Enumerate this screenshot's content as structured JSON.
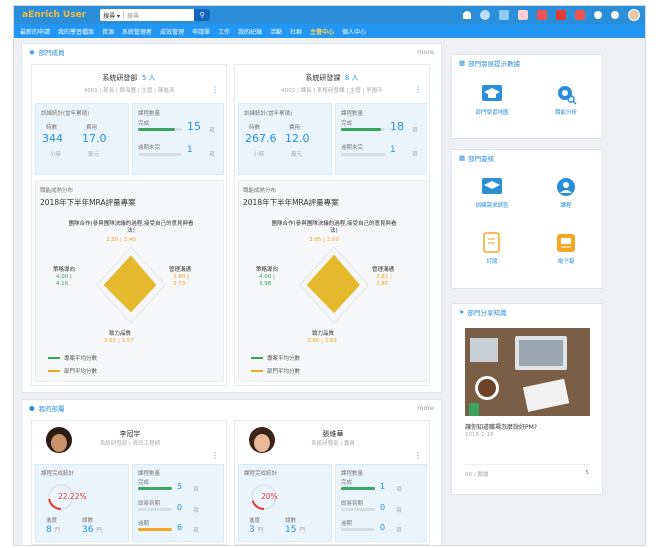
{
  "topbar": {
    "logo_a": "aEnrich",
    "logo_b": "User",
    "search_scope": "搜尋 ▾",
    "search_placeholder": "搜尋"
  },
  "nav": [
    "最新的申請",
    "我的學習檔案",
    "資源",
    "系統管理者",
    "成效管理",
    "申請單",
    "工作",
    "我的紀錄",
    "活動",
    "社群",
    "主管中心",
    "個人中心"
  ],
  "nav_active": "主管中心",
  "dept": {
    "title": "部門成員",
    "more": "more",
    "units": [
      {
        "name": "系統研發部",
        "count": "5 人",
        "meta": "4001 | 部長 | 鄭海豐 | 主管 | 陳進清",
        "hours_title": "訓練統計(當年累積)",
        "hours_lbl": "時數",
        "hours_val": "344",
        "hours_unit": "小時",
        "cost_lbl": "費用",
        "cost_val": "17.0",
        "cost_unit": "萬元",
        "course_title": "課程數量",
        "course_done_lbl": "完成",
        "course_done_val": "15",
        "course_unit": "項",
        "course_over_lbl": "逾期未完",
        "course_over_val": "1",
        "course_done_pct": 0.85,
        "radar_title": "職能成熟分布",
        "radar_sub": "2018年下半年MRA評量專案",
        "axes": [
          "團隊合作(參與團隊決議的過程,接受自己的意見與看法)",
          "管理溝通",
          "致力品質",
          "策略導向"
        ],
        "values_dept": [
          "3.50 | 3.40",
          "3.80 | 3.73",
          "3.65 | 3.57",
          "4.00 | 4.16"
        ],
        "radar_pct": [
          0.78,
          0.74,
          0.72,
          0.8
        ],
        "legend": [
          "專案平均分數",
          "部門平均分數"
        ]
      },
      {
        "name": "系統研發課",
        "count": "8 人",
        "meta": "4002 | 課長 | 系統研發課 | 主管 | 李國平",
        "hours_title": "訓練統計(當年累積)",
        "hours_lbl": "時數",
        "hours_val": "267.6",
        "hours_unit": "小時",
        "cost_lbl": "費用",
        "cost_val": "12.0",
        "cost_unit": "萬元",
        "course_title": "課程數量",
        "course_done_lbl": "完成",
        "course_done_val": "18",
        "course_unit": "項",
        "course_over_lbl": "逾期未完",
        "course_over_val": "1",
        "course_done_pct": 0.9,
        "radar_title": "職能成熟分布",
        "radar_sub": "2018年下半年MRA評量專案",
        "axes": [
          "團隊合作(參與團隊決議的過程,接受自己的意見與看法)",
          "管理溝通",
          "致力品質",
          "策略導向"
        ],
        "values_dept": [
          "3.95 | 3.60",
          "3.82 | 3.85",
          "3.86 | 3.83",
          "4.00 | 3.98"
        ],
        "radar_pct": [
          0.8,
          0.76,
          0.74,
          0.8
        ],
        "legend": [
          "專案平均分數",
          "部門平均分數"
        ]
      }
    ]
  },
  "staff": {
    "title": "我的部屬",
    "more": "more",
    "people": [
      {
        "name": "李冠宇",
        "meta": "系統研發部 | 資訊工程師",
        "stat_title": "課程完成統計",
        "pct": "22.22%",
        "pct_num": 0.2222,
        "a_lbl": "進度",
        "a_val": "8",
        "a_unit": "門",
        "b_lbl": "總數",
        "b_val": "36",
        "b_unit": "門",
        "course_title": "課程數量",
        "r1_lbl": "完成",
        "r1_val": "5",
        "r2_lbl": "即將到期",
        "r2_val": "0",
        "r3_lbl": "逾期",
        "r3_val": "6",
        "unit": "項"
      },
      {
        "name": "張維華",
        "meta": "系統研發部 | 專員",
        "stat_title": "課程完成統計",
        "pct": "20%",
        "pct_num": 0.2,
        "a_lbl": "進度",
        "a_val": "3",
        "a_unit": "門",
        "b_lbl": "總數",
        "b_val": "15",
        "b_unit": "門",
        "course_title": "課程數量",
        "r1_lbl": "完成",
        "r1_val": "1",
        "r2_lbl": "即將到期",
        "r2_val": "0",
        "r3_lbl": "逾期",
        "r3_val": "0",
        "unit": "項"
      }
    ]
  },
  "manager_tools": {
    "title": "部門發展提示數據",
    "items": [
      "部門學習地圖",
      "職能分析"
    ]
  },
  "records": {
    "title": "部門簽核",
    "items": [
      "訓練需求調查",
      "課程",
      "訂閱",
      "電子報"
    ]
  },
  "article": {
    "title": "部門分享知識",
    "headline": "讓你知道職場怎麼說好PM?",
    "date": "2018-1-18",
    "footer_left": "00 / 閱讀",
    "footer_right": "5"
  },
  "colors": {
    "primary": "#2a8fd8",
    "nav": "#2196f3",
    "radar_fill": "#e4b92c",
    "green": "#3aa35c",
    "orange": "#f5a623",
    "red": "#e53935"
  }
}
